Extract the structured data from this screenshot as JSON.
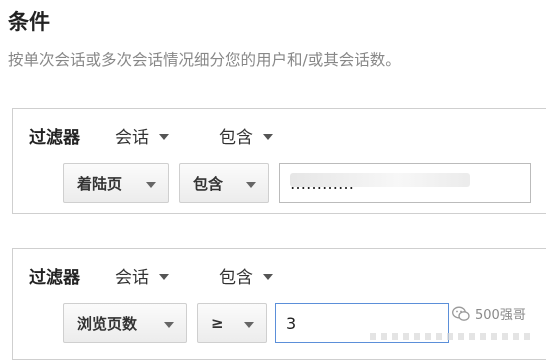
{
  "header": {
    "title": "条件",
    "subtitle": "按单次会话或多次会话情况细分您的用户和/或其会话数。"
  },
  "filters": [
    {
      "label": "过滤器",
      "scope": "会话",
      "mode": "包含",
      "dimension": "着陆页",
      "operator": "包含",
      "value": "…………"
    },
    {
      "label": "过滤器",
      "scope": "会话",
      "mode": "包含",
      "dimension": "浏览页数",
      "operator": "≥",
      "value": "3"
    }
  ],
  "watermark": {
    "text": "500强哥",
    "icon": "wechat-icon"
  },
  "colors": {
    "title": "#222222",
    "subtitle": "#888888",
    "border": "#cfcfcf",
    "focus": "#5b8fd9"
  }
}
